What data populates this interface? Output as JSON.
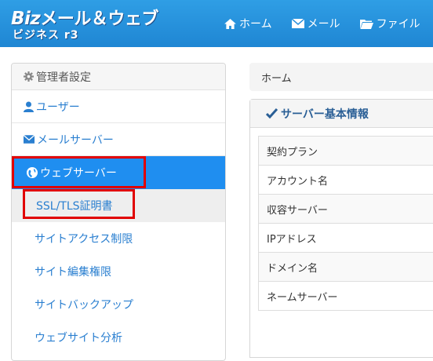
{
  "header": {
    "logo_main": "Biz",
    "logo_rest": "メール＆ウェブ",
    "logo_sub": "ビジネス r3",
    "nav": [
      {
        "label": "ホーム",
        "icon": "home-icon"
      },
      {
        "label": "メール",
        "icon": "envelope-icon"
      },
      {
        "label": "ファイル",
        "icon": "folder-icon"
      }
    ]
  },
  "sidebar": {
    "heading": "管理者設定",
    "items": [
      {
        "label": "ユーザー",
        "icon": "user-icon"
      },
      {
        "label": "メールサーバー",
        "icon": "envelope-icon"
      },
      {
        "label": "ウェブサーバー",
        "icon": "globe-icon",
        "active": true
      }
    ],
    "sub_items": [
      {
        "label": "SSL/TLS証明書",
        "selected": true
      },
      {
        "label": "サイトアクセス制限"
      },
      {
        "label": "サイト編集権限"
      },
      {
        "label": "サイトバックアップ"
      },
      {
        "label": "ウェブサイト分析"
      }
    ]
  },
  "breadcrumb": "ホーム",
  "panel": {
    "title": "サーバー基本情報",
    "rows": [
      "契約プラン",
      "アカウント名",
      "収容サーバー",
      "IPアドレス",
      "ドメイン名",
      "ネームサーバー"
    ]
  },
  "colors": {
    "header": "#2a95e0",
    "accent": "#1f8ef0",
    "link": "#2a7fd0",
    "highlight": "#e10000"
  }
}
